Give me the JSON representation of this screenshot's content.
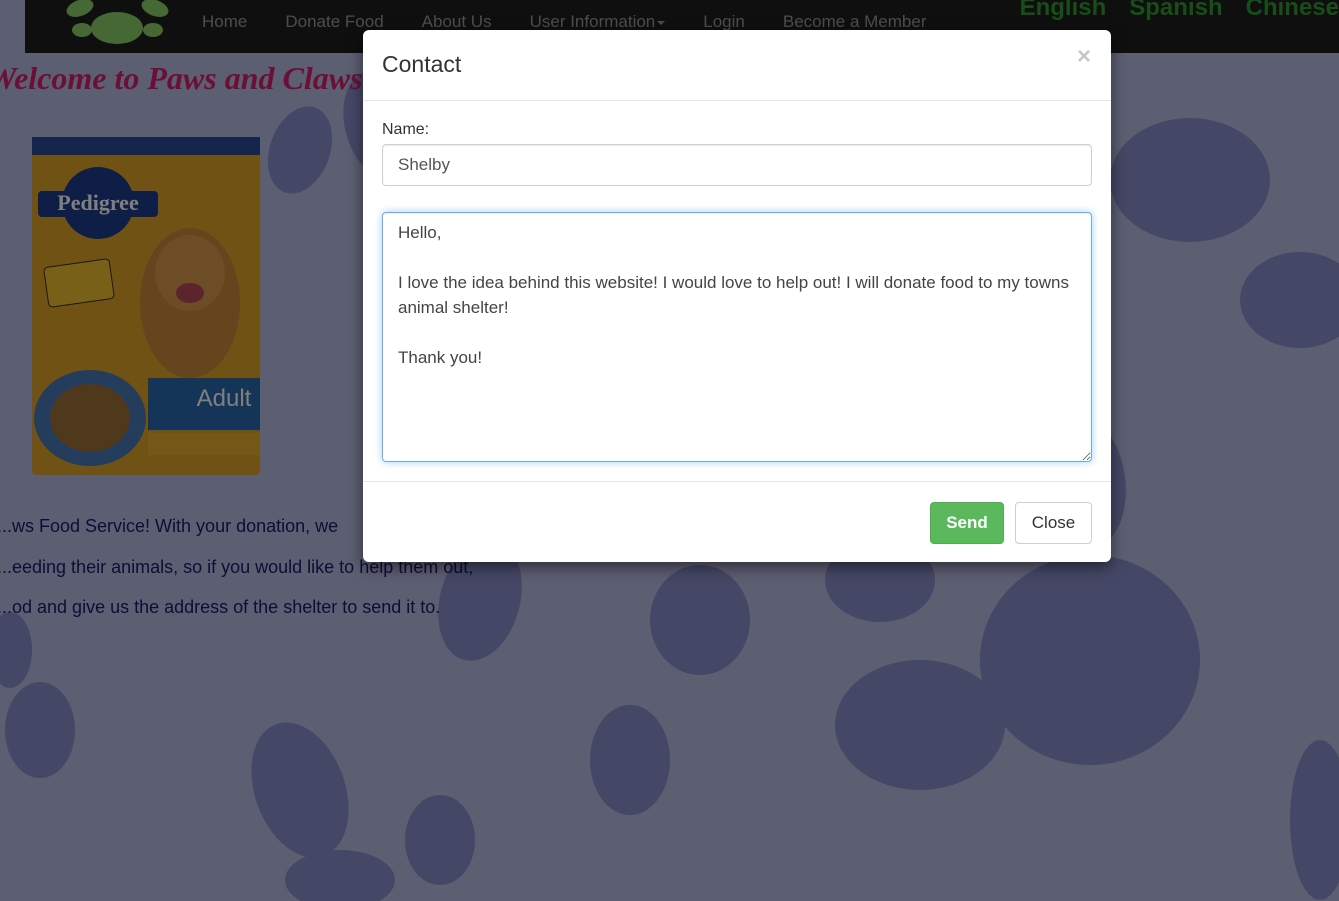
{
  "navbar": {
    "items": [
      "Home",
      "Donate Food",
      "About Us",
      "User Information",
      "Login",
      "Become a Member"
    ],
    "languages": [
      "English",
      "Spanish",
      "Chinese"
    ]
  },
  "page": {
    "welcome_title": "Welcome to Paws and Claws Food Service!",
    "product_image": "pedigree-dog-food-bag",
    "intro_lines": [
      "...ws Food Service! With your donation, we",
      "...eeding their animals, so if you would like to help them out,",
      "...od and give us the address of the shelter to send it to."
    ]
  },
  "modal": {
    "title": "Contact",
    "close_symbol": "×",
    "name_label": "Name:",
    "name_value": "Shelby",
    "message_value": "Hello,\n\nI love the idea behind this website! I would love to help out! I will donate food to my towns animal shelter!\n\nThank you!",
    "send_label": "Send",
    "close_label": "Close"
  },
  "colors": {
    "background": "#b9bde4",
    "navbar": "#1f1f1f",
    "title": "#d91e6d",
    "language_link": "#2e9b2e",
    "send_button": "#5cb85c",
    "focus_border": "#66afe9"
  }
}
